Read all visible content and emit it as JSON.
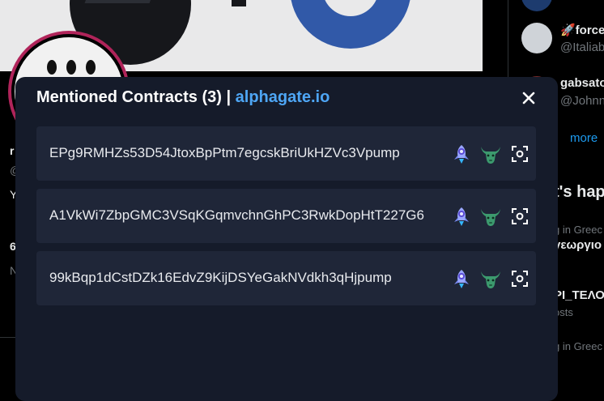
{
  "modal": {
    "title": "Mentioned Contracts (3)",
    "separator": "|",
    "brand_link": "alphagate.io",
    "close_icon": "close-icon",
    "contracts": [
      {
        "address": "EPg9RMHZs53D54JtoxBpPtm7egcskBriUkHZVc3Vpump",
        "icons": [
          "rocket-icon",
          "bull-icon",
          "scan-icon"
        ]
      },
      {
        "address": "A1VkWi7ZbpGMC3VSqKGqmvchnGhPC3RwkDopHtT227G6",
        "icons": [
          "rocket-icon",
          "bull-icon",
          "scan-icon"
        ]
      },
      {
        "address": "99kBqp1dCstDZk16EdvZ9KijDSYeGakNVdkh3qHjpump",
        "icons": [
          "rocket-icon",
          "bull-icon",
          "scan-icon"
        ]
      }
    ]
  },
  "background": {
    "left": {
      "letters": [
        "r",
        "@",
        "Y",
        "6",
        "N"
      ]
    },
    "right": {
      "accounts": [
        {
          "name": "🚀force",
          "handle": "@Italiab"
        },
        {
          "name": "gabsato",
          "handle": "@Johnn"
        }
      ],
      "show_more": "more",
      "section_heading": "t's hap",
      "trends": [
        {
          "context": "g in Greec",
          "title": "γεωργιο"
        },
        {
          "context": "",
          "title": "ΡΙ_ΤΕΛΟ"
        },
        {
          "context": "osts",
          "title": ""
        },
        {
          "context": "g in Greec",
          "title": ""
        }
      ]
    }
  },
  "colors": {
    "modal_bg": "#151b2a",
    "row_bg": "#1f2638",
    "link": "#4ea6f5",
    "avatar_ring": "#b0245a"
  }
}
